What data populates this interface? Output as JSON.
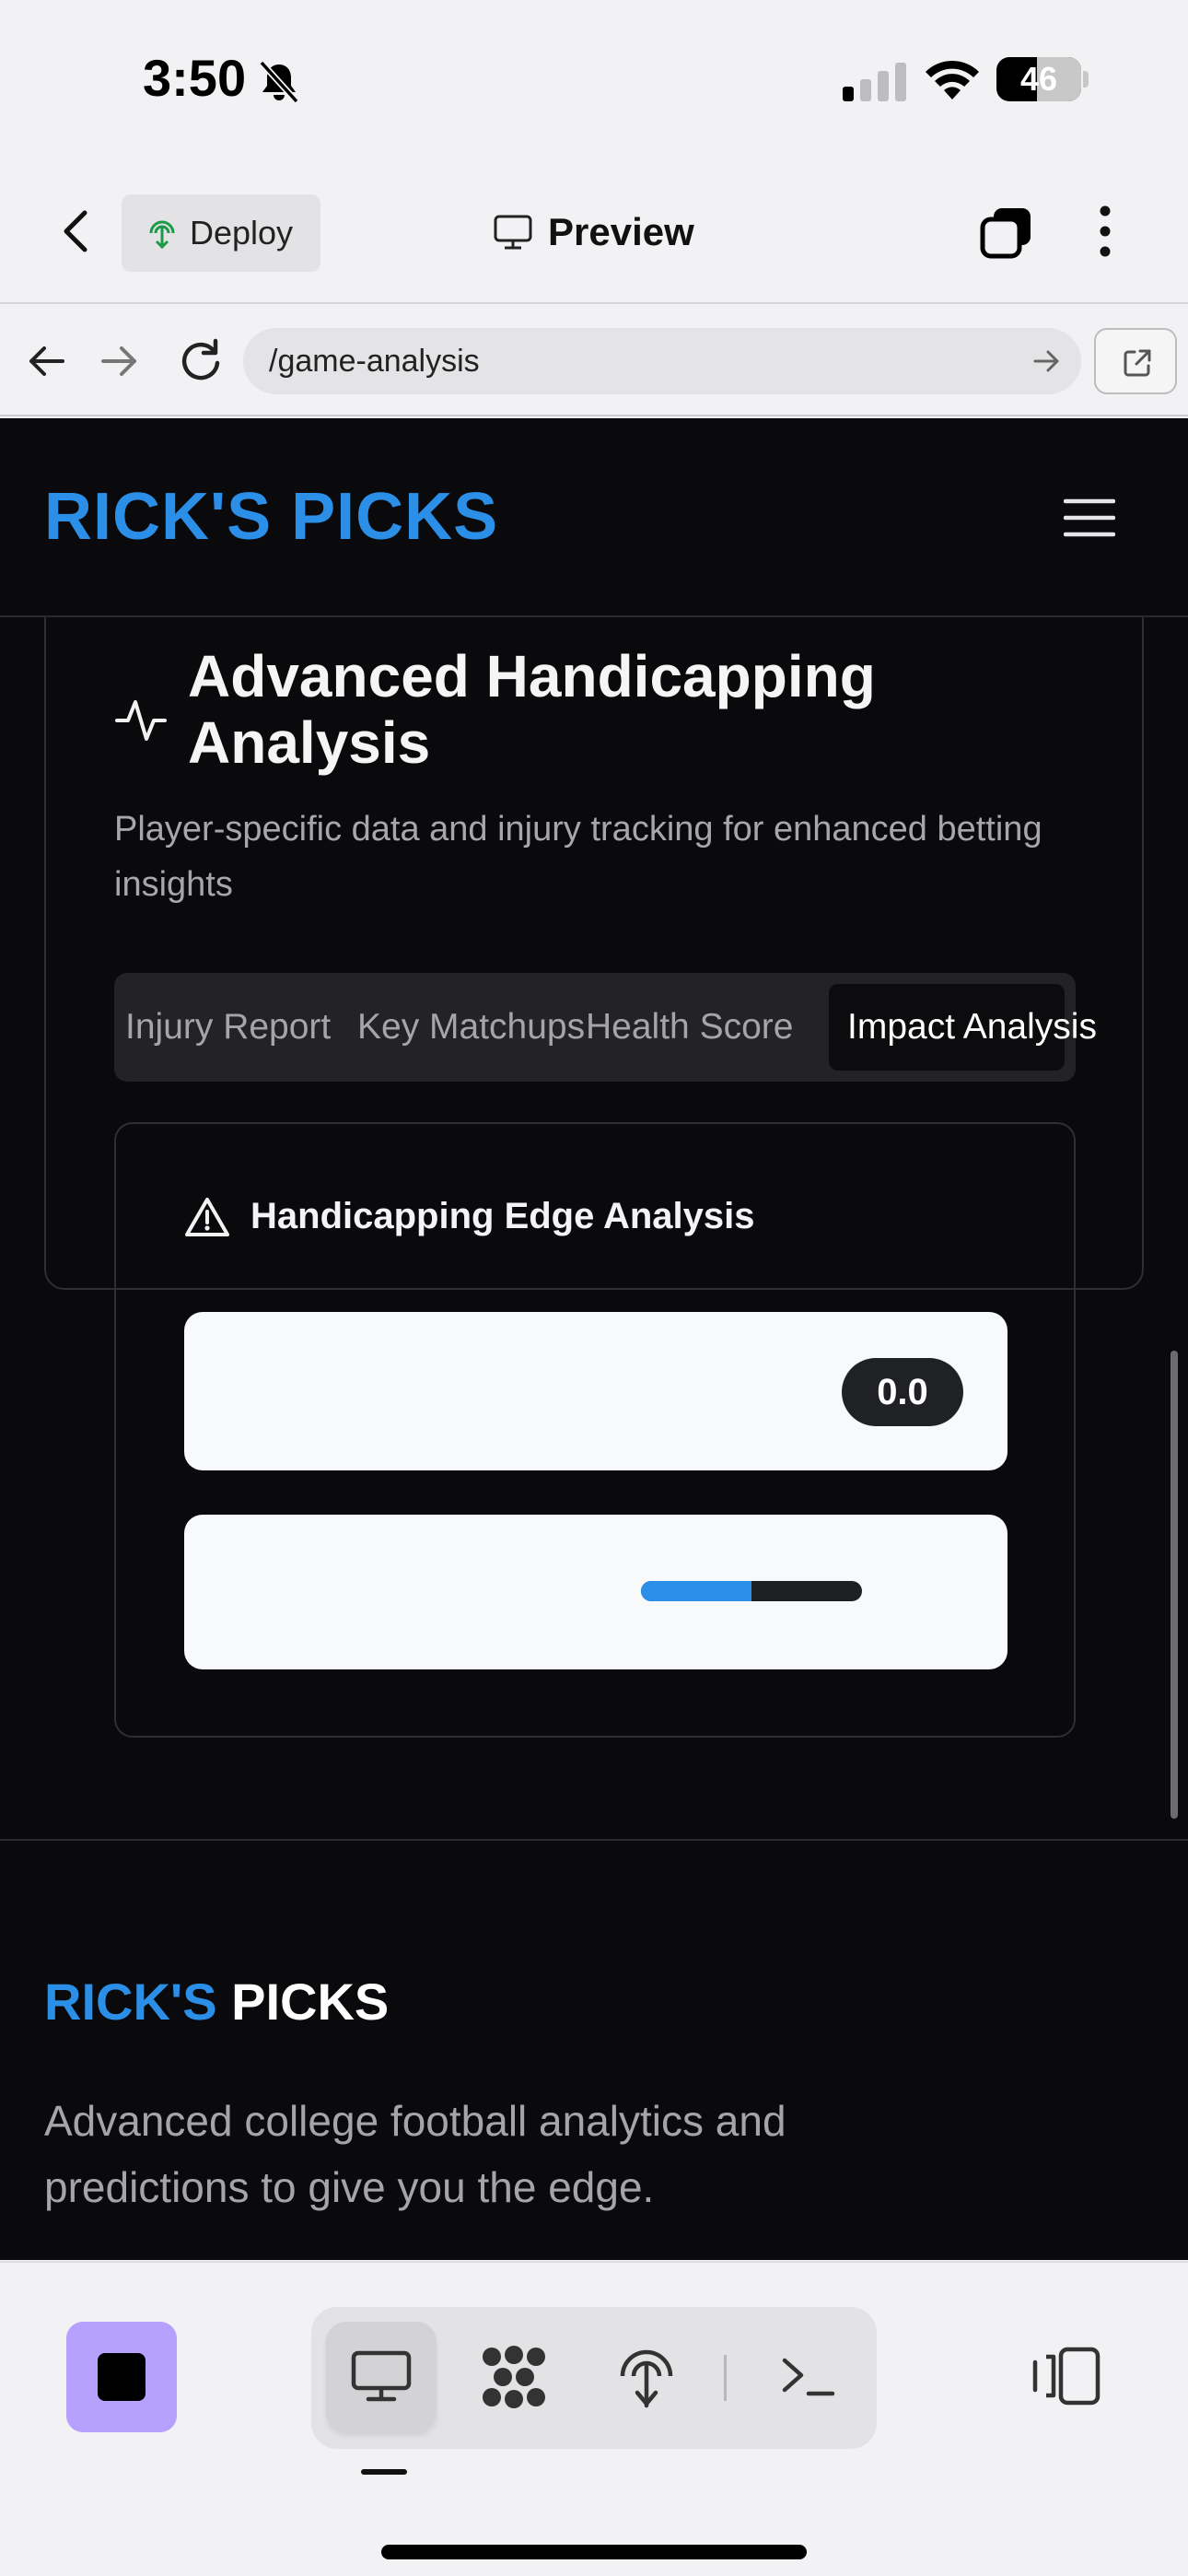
{
  "status_bar": {
    "time": "3:50",
    "battery": "46",
    "icons": [
      "bell-slash-icon",
      "signal-icon",
      "wifi-icon",
      "battery-icon"
    ]
  },
  "toolbar": {
    "deploy_label": "Deploy",
    "preview_label": "Preview"
  },
  "browser": {
    "url": "/game-analysis"
  },
  "site": {
    "logo": "RICK'S PICKS",
    "card": {
      "title": "Advanced Handicapping Analysis",
      "description": "Player-specific data and injury tracking for enhanced betting insights",
      "tabs": [
        {
          "label": "Injury Report",
          "active": false
        },
        {
          "label": "Key Matchups",
          "active": false
        },
        {
          "label": "Health Score",
          "active": false
        },
        {
          "label": "Impact Analysis",
          "active": true
        }
      ],
      "edge": {
        "title": "Handicapping Edge Analysis",
        "score": "0.0",
        "progress_fraction": 0.5
      }
    },
    "footer": {
      "logo_part1": "RICK'S",
      "logo_part2": "PICKS",
      "description": "Advanced college football analytics and predictions to give you the edge."
    }
  },
  "colors": {
    "brand_blue": "#2b8fe8",
    "dark_bg": "#0a0a0c",
    "stop_purple": "#b7a1ff"
  }
}
